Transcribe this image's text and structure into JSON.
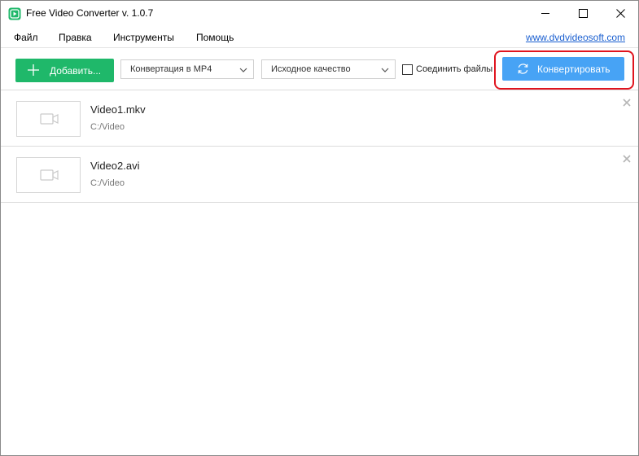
{
  "window": {
    "title": "Free Video Converter v. 1.0.7",
    "icons": {
      "app": "app-logo-icon",
      "minimize": "minimize-icon",
      "maximize": "maximize-icon",
      "close": "close-icon"
    }
  },
  "menu": {
    "items": [
      "Файл",
      "Правка",
      "Инструменты",
      "Помощь"
    ],
    "link": "www.dvdvideosoft.com"
  },
  "toolbar": {
    "add_label": "Добавить...",
    "format_value": "Конвертация в MP4",
    "quality_value": "Исходное качество",
    "join_label": "Соединить файлы",
    "join_checked": false,
    "convert_label": "Конвертировать"
  },
  "files": [
    {
      "name": "Video1.mkv",
      "path": "C:/Video"
    },
    {
      "name": "Video2.avi",
      "path": "C:/Video"
    }
  ],
  "colors": {
    "add_button": "#1fb86a",
    "convert_button": "#47a3f5",
    "highlight_ring": "#e0141e",
    "link": "#1a5fd0"
  }
}
